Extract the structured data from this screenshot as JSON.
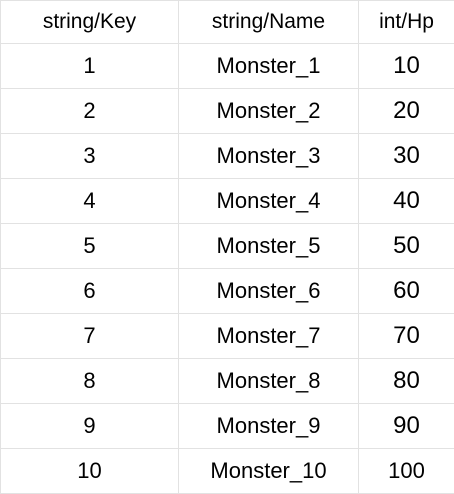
{
  "table": {
    "headers": [
      "string/Key",
      "string/Name",
      "int/Hp"
    ],
    "rows": [
      [
        "1",
        "Monster_1",
        "10"
      ],
      [
        "2",
        "Monster_2",
        "20"
      ],
      [
        "3",
        "Monster_3",
        "30"
      ],
      [
        "4",
        "Monster_4",
        "40"
      ],
      [
        "5",
        "Monster_5",
        "50"
      ],
      [
        "6",
        "Monster_6",
        "60"
      ],
      [
        "7",
        "Monster_7",
        "70"
      ],
      [
        "8",
        "Monster_8",
        "80"
      ],
      [
        "9",
        "Monster_9",
        "90"
      ],
      [
        "10",
        "Monster_10",
        "100"
      ]
    ]
  }
}
